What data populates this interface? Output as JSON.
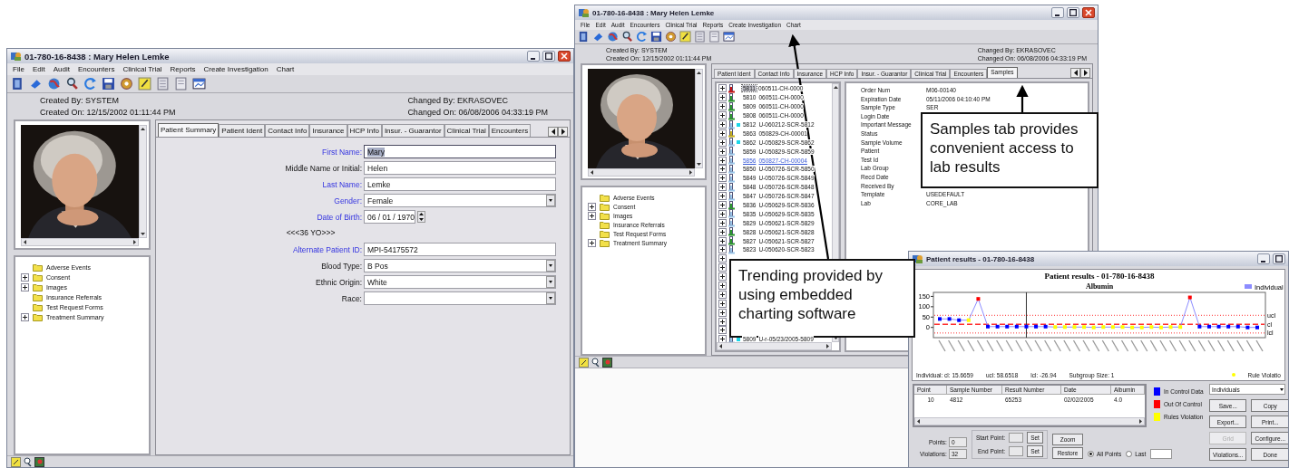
{
  "patient_window": {
    "title": "01-780-16-8438 : Mary  Helen Lemke",
    "menu": [
      "File",
      "Edit",
      "Audit",
      "Encounters",
      "Clinical Trial",
      "Reports",
      "Create Investigation",
      "Chart"
    ],
    "created_by": "Created By: SYSTEM",
    "created_on": "Created On: 12/15/2002 01:11:44 PM",
    "changed_by": "Changed By:  EKRASOVEC",
    "changed_on": "Changed On:  06/08/2006 04:33:19 PM",
    "folders": [
      {
        "label": "Adverse Events",
        "expandable": false
      },
      {
        "label": "Consent",
        "expandable": true
      },
      {
        "label": "Images",
        "expandable": true
      },
      {
        "label": "Insurance Referrals",
        "expandable": false
      },
      {
        "label": "Test Request Forms",
        "expandable": false
      },
      {
        "label": "Treatment Summary",
        "expandable": true
      }
    ],
    "tabs": [
      {
        "label": "Patient Summary",
        "selected": true
      },
      {
        "label": "Patient Ident",
        "selected": false
      },
      {
        "label": "Contact Info",
        "selected": false
      },
      {
        "label": "Insurance",
        "selected": false
      },
      {
        "label": "HCP Info",
        "selected": false
      },
      {
        "label": "Insur. - Guarantor",
        "selected": false
      },
      {
        "label": "Clinical Trial",
        "selected": false
      },
      {
        "label": "Encounters",
        "selected": false
      }
    ],
    "fields": [
      {
        "kind": "text",
        "label": "First Name:",
        "required": true,
        "value": "Mary",
        "highlighted": true
      },
      {
        "kind": "text",
        "label": "Middle Name or Initial:",
        "required": false,
        "value": "Helen",
        "highlighted": false
      },
      {
        "kind": "text",
        "label": "Last Name:",
        "required": true,
        "value": "Lemke",
        "highlighted": false
      },
      {
        "kind": "select",
        "label": "Gender:",
        "required": true,
        "value": "Female",
        "highlighted": false
      },
      {
        "kind": "date",
        "label": "Date of Birth:",
        "required": true,
        "value": "06 / 01 / 1970",
        "highlighted": false
      },
      {
        "kind": "note",
        "value": "<<<36 YO>>>"
      },
      {
        "kind": "text",
        "label": "Alternate Patient ID:",
        "required": true,
        "value": "MPI-54175572",
        "highlighted": false
      },
      {
        "kind": "select",
        "label": "Blood Type:",
        "required": false,
        "value": "B Pos",
        "highlighted": false
      },
      {
        "kind": "select",
        "label": "Ethnic Origin:",
        "required": false,
        "value": "White",
        "highlighted": false
      },
      {
        "kind": "select",
        "label": "Race:",
        "required": false
      }
    ]
  },
  "samples_window": {
    "title": "01-780-16-8438 : Mary  Helen Lemke",
    "menu": [
      "File",
      "Edit",
      "Audit",
      "Encounters",
      "Clinical Trial",
      "Reports",
      "Create Investigation",
      "Chart"
    ],
    "created_by": "Created By: SYSTEM",
    "created_on": "Created On: 12/15/2002 01:11:44 PM",
    "changed_by": "Changed By:  EKRASOVEC",
    "changed_on": "Changed On:  06/08/2006 04:33:19 PM",
    "folders": [
      {
        "label": "Adverse Events",
        "expandable": false
      },
      {
        "label": "Consent",
        "expandable": true
      },
      {
        "label": "Images",
        "expandable": true
      },
      {
        "label": "Insurance Referrals",
        "expandable": false
      },
      {
        "label": "Test Request Forms",
        "expandable": false
      },
      {
        "label": "Treatment Summary",
        "expandable": true
      }
    ],
    "tabs": [
      {
        "label": "Patient Ident",
        "selected": false
      },
      {
        "label": "Contact Info",
        "selected": false
      },
      {
        "label": "Insurance",
        "selected": false
      },
      {
        "label": "HCP Info",
        "selected": false
      },
      {
        "label": "Insur. - Guarantor",
        "selected": false
      },
      {
        "label": "Clinical Trial",
        "selected": false
      },
      {
        "label": "Encounters",
        "selected": false
      },
      {
        "label": "Samples",
        "selected": true
      }
    ],
    "rows": [
      {
        "kind": "sample",
        "number": "5811",
        "label": "060511-CH-0000",
        "color": "#cc1111",
        "flagged": false,
        "selected": true,
        "link": false
      },
      {
        "kind": "sample",
        "number": "5810",
        "label": "060511-CH-0000",
        "color": "#2a9a2a",
        "flagged": false,
        "selected": false,
        "link": false
      },
      {
        "kind": "sample",
        "number": "5809",
        "label": "060511-CH-0000",
        "color": "#2a9a2a",
        "flagged": false,
        "selected": false,
        "link": false
      },
      {
        "kind": "sample",
        "number": "5808",
        "label": "060511-CH-0000",
        "color": "#2a9a2a",
        "flagged": false,
        "selected": false,
        "link": false
      },
      {
        "kind": "sample",
        "number": "5812",
        "label": "U-060212-SCR-5812",
        "color": "#9cc7ea",
        "flagged": true,
        "selected": false,
        "link": false
      },
      {
        "kind": "sample",
        "number": "5863",
        "label": "050829-CH-00001",
        "color": "#c9b11a",
        "flagged": false,
        "selected": false,
        "link": false
      },
      {
        "kind": "sample",
        "number": "5862",
        "label": "U-050829-SCR-5862",
        "color": "#9cc7ea",
        "flagged": true,
        "selected": false,
        "link": false
      },
      {
        "kind": "sample",
        "number": "5859",
        "label": "U-050829-SCR-5859",
        "color": "#9cc7ea",
        "flagged": false,
        "selected": false,
        "link": false
      },
      {
        "kind": "sample",
        "number": "5856",
        "label": "050827-CH-00004",
        "color": "#9cc7ea",
        "flagged": false,
        "selected": false,
        "link": true
      },
      {
        "kind": "sample",
        "number": "5850",
        "label": "U-050726-SCR-5850",
        "color": "#9cc7ea",
        "flagged": false,
        "selected": false,
        "link": false
      },
      {
        "kind": "sample",
        "number": "5849",
        "label": "U-050726-SCR-5849",
        "color": "#9cc7ea",
        "flagged": false,
        "selected": false,
        "link": false
      },
      {
        "kind": "sample",
        "number": "5848",
        "label": "U-050726-SCR-5848",
        "color": "#9cc7ea",
        "flagged": false,
        "selected": false,
        "link": false
      },
      {
        "kind": "sample",
        "number": "5847",
        "label": "U-050726-SCR-5847",
        "color": "#9cc7ea",
        "flagged": false,
        "selected": false,
        "link": false
      },
      {
        "kind": "sample",
        "number": "5836",
        "label": "U-050629-SCR-5836",
        "color": "#2a9a2a",
        "flagged": false,
        "selected": false,
        "link": false
      },
      {
        "kind": "sample",
        "number": "5835",
        "label": "U-050629-SCR-5835",
        "color": "#9cc7ea",
        "flagged": false,
        "selected": false,
        "link": false
      },
      {
        "kind": "sample",
        "number": "5829",
        "label": "U-050621-SCR-5829",
        "color": "#9cc7ea",
        "flagged": false,
        "selected": false,
        "link": false
      },
      {
        "kind": "sample",
        "number": "5828",
        "label": "U-050621-SCR-5828",
        "color": "#2a9a2a",
        "flagged": false,
        "selected": false,
        "link": false
      },
      {
        "kind": "sample",
        "number": "5827",
        "label": "U-050621-SCR-5827",
        "color": "#2a9a2a",
        "flagged": false,
        "selected": false,
        "link": false
      },
      {
        "kind": "sample",
        "number": "5823",
        "label": "U-050620-SCR-5823",
        "color": "#9cc7ea",
        "flagged": false,
        "selected": false,
        "link": false
      },
      {
        "kind": "covered"
      },
      {
        "kind": "covered"
      },
      {
        "kind": "covered"
      },
      {
        "kind": "covered"
      },
      {
        "kind": "covered"
      },
      {
        "kind": "covered"
      },
      {
        "kind": "covered"
      },
      {
        "kind": "covered"
      },
      {
        "kind": "covered"
      },
      {
        "kind": "sample",
        "number": "5809",
        "label": "U-r-05/23/2005-5809",
        "color": "#9cc7ea",
        "flagged": true,
        "selected": false,
        "link": false
      }
    ],
    "details": [
      {
        "label": "Order Num",
        "value": "M06-00140"
      },
      {
        "label": "Expiration Date",
        "value": "05/11/2006 04:10:40 PM"
      },
      {
        "label": "Sample Type",
        "value": "SER"
      },
      {
        "label": "Login Date"
      },
      {
        "label": "Important Message"
      },
      {
        "label": "Status"
      },
      {
        "label": "Sample Volume"
      },
      {
        "label": "Patient"
      },
      {
        "label": "Test Id"
      },
      {
        "label": "Lab Group"
      },
      {
        "label": "Recd Date"
      },
      {
        "label": "Received By"
      },
      {
        "label": "Template",
        "value": "USEDEFAULT"
      },
      {
        "label": "Lab",
        "value": "CORE_LAB"
      }
    ]
  },
  "results_window": {
    "title": "Patient results - 01-780-16-8438",
    "chart": {
      "subtitle": "Albumin",
      "chart_data": {
        "type": "line",
        "title": "Patient results - 01-780-16-8438",
        "ylim": [
          -45,
          165
        ],
        "yticks": [
          0,
          50,
          100,
          150
        ],
        "series": [
          {
            "name": "Individual",
            "color": "#8c8cff",
            "marker": "square",
            "values": [
              41,
              41,
              35,
              35,
              138,
              4,
              4,
              4,
              4,
              4,
              4,
              4,
              2,
              2,
              2,
              2,
              0,
              2,
              2,
              2,
              0,
              0,
              2,
              0,
              2,
              2,
              145,
              4,
              4,
              4,
              4,
              4,
              0,
              0
            ]
          }
        ],
        "ref_lines": [
          {
            "axis": "y",
            "value": 58.6518,
            "label": "ucl"
          },
          {
            "axis": "y",
            "value": 15.6659,
            "label": "cl"
          },
          {
            "axis": "y",
            "value": -26.94,
            "label": "lcl"
          }
        ]
      },
      "points": [
        {
          "color": "#0000ff"
        },
        {
          "color": "#0000ff"
        },
        {
          "color": "#0000ff"
        },
        {
          "color": "#ffff00"
        },
        {
          "color": "#ff0000"
        },
        {
          "color": "#0000ff"
        },
        {
          "color": "#0000ff"
        },
        {
          "color": "#0000ff"
        },
        {
          "color": "#0000ff"
        },
        {
          "color": "#0000ff"
        },
        {
          "color": "#0000ff"
        },
        {
          "color": "#0000ff"
        },
        {
          "color": "#ffff00"
        },
        {
          "color": "#ffff00"
        },
        {
          "color": "#ffff00"
        },
        {
          "color": "#ffff00"
        },
        {
          "color": "#ffff00"
        },
        {
          "color": "#ffff00"
        },
        {
          "color": "#ffff00"
        },
        {
          "color": "#ffff00"
        },
        {
          "color": "#ffff00"
        },
        {
          "color": "#ffff00"
        },
        {
          "color": "#ffff00"
        },
        {
          "color": "#ffff00"
        },
        {
          "color": "#ffff00"
        },
        {
          "color": "#ffff00"
        },
        {
          "color": "#ff0000"
        },
        {
          "color": "#0000ff"
        },
        {
          "color": "#0000ff"
        },
        {
          "color": "#0000ff"
        },
        {
          "color": "#0000ff"
        },
        {
          "color": "#0000ff"
        },
        {
          "color": "#0000ff"
        },
        {
          "color": "#0000ff"
        }
      ],
      "stats": [
        "Individual:  cl: 15.6659",
        "ucl: 58.6518",
        "lcl: -26.94",
        "Subgroup Size:  1"
      ],
      "rule_legend": {
        "label": "Rule Violatio",
        "color": "#ffff00"
      }
    },
    "table": {
      "columns": [
        "Point",
        "Sample Number",
        "Result Number",
        "Date",
        "Albumin"
      ],
      "rows": [
        [
          "10",
          "4812",
          "65253",
          "02/02/2005",
          "4.0"
        ]
      ]
    },
    "legend": [
      {
        "label": "In Control Data",
        "color": "#0000ff"
      },
      {
        "label": "Out Of Control",
        "color": "#ff0000"
      },
      {
        "label": "Rules Violation",
        "color": "#ffff00"
      }
    ],
    "view_select": "Individuals",
    "buttons": [
      {
        "label": "Save...",
        "disabled": false
      },
      {
        "label": "Copy",
        "disabled": false
      },
      {
        "label": "Export...",
        "disabled": false
      },
      {
        "label": "Print...",
        "disabled": false
      },
      {
        "label": "Grid",
        "disabled": true
      },
      {
        "label": "Configure...",
        "disabled": false
      },
      {
        "label": "Violations...",
        "disabled": false
      },
      {
        "label": "Done",
        "disabled": false
      }
    ],
    "points_label": "Points:",
    "points_value": "0",
    "violations_label": "Violations:",
    "violations_value": "32",
    "start_label": "Start Point:",
    "end_label": "End Point:",
    "set_buttons": [
      "Set",
      "Set"
    ],
    "zoom_button": "Zoom",
    "restore_button": "Restore",
    "radios": [
      {
        "label": "All Points",
        "selected": true
      },
      {
        "label": "Last",
        "selected": false
      }
    ]
  },
  "callouts": [
    {
      "text": "Samples tab provides convenient access to lab results",
      "kind": "samples"
    },
    {
      "text": "Trending provided by using embedded charting software",
      "kind": "trending"
    }
  ]
}
